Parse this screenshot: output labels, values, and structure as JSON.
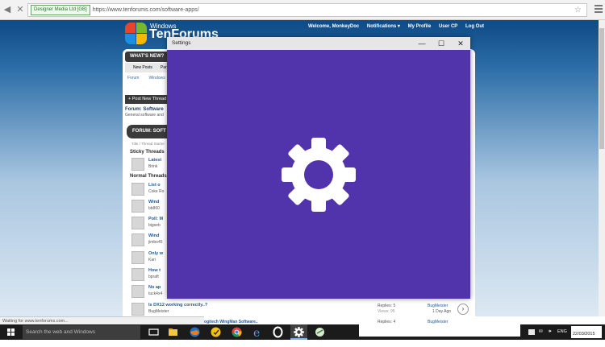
{
  "browser": {
    "cert_label": "Designer Media Ltd [GB]",
    "url": "https://www.tenforums.com/software-apps/",
    "status_text": "Waiting for www.tenforums.com..."
  },
  "site": {
    "logo_small": "Windows",
    "logo_big": "TenForums",
    "toplinks": [
      "Welcome, MonkeyDoc",
      "Notifications ▾",
      "My Profile",
      "User CP",
      "Log Out"
    ],
    "whats_new": "WHAT'S NEW?",
    "sub_tabs": [
      "New Posts",
      "Part"
    ],
    "crumbs": [
      "Forum",
      "Windows"
    ],
    "post_button": "+ Post New Thread",
    "forum_title": "Forum: Software",
    "forum_desc": "General software and",
    "forum_bar": "FORUM: SOFT",
    "title_start": "Title / Thread Starter",
    "sticky_heading": "Sticky Threads",
    "normal_heading": "Normal Threads",
    "sticky_threads": [
      {
        "title": "Latest",
        "author": "Brink"
      }
    ],
    "threads": [
      {
        "title": "List o",
        "author": "Coke Ro"
      },
      {
        "title": "Wind",
        "author": "bb860"
      },
      {
        "title": "Poll: M",
        "author": "bigseb"
      },
      {
        "title": "Wind",
        "author": "jimbo45"
      },
      {
        "title": "Only w",
        "author": "Kari"
      },
      {
        "title": "How t",
        "author": "bpraft"
      },
      {
        "title": "No ap",
        "author": "tuck4x4"
      },
      {
        "title": "Is DX12 working correctly..?",
        "author": "BugMeister"
      },
      {
        "title": "Logitech WingMan Software..",
        "author": ""
      }
    ],
    "thread_stats": {
      "replies_label": "Replies: 5",
      "views_label": "Views: 95",
      "last_poster": "BugMeister",
      "last_time": "1 Day Ago",
      "replies2_label": "Replies: 4",
      "last_poster2": "BugMeister"
    }
  },
  "settings_window": {
    "title": "Settings",
    "minimize": "—",
    "maximize": "☐",
    "close": "✕",
    "accent": "#5133ab"
  },
  "taskbar": {
    "search_placeholder": "Search the web and Windows",
    "lang": "ENG",
    "time": "",
    "date": "22/03/2015"
  }
}
